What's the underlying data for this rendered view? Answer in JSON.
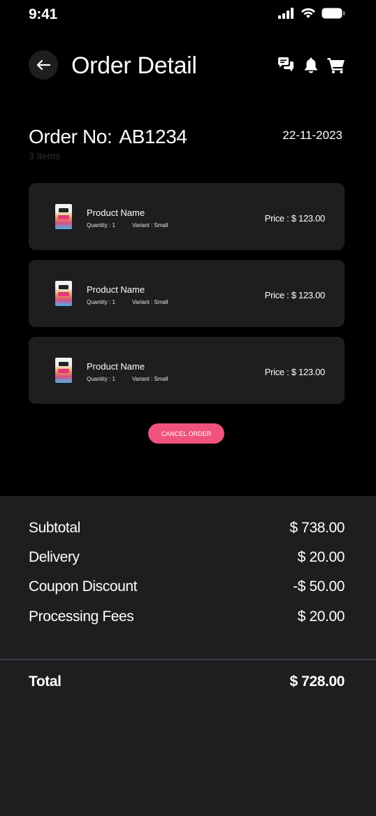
{
  "status_bar": {
    "time": "9:41"
  },
  "header": {
    "title": "Order Detail"
  },
  "order": {
    "number_label": "Order No:",
    "number": "AB1234",
    "date": "22-11-2023",
    "item_count": "3 items"
  },
  "items": [
    {
      "name": "Product Name",
      "quantity": "Quantity : 1",
      "variant": "Variant : Small",
      "price": "Price : $ 123.00"
    },
    {
      "name": "Product Name",
      "quantity": "Quantity : 1",
      "variant": "Variant : Small",
      "price": "Price : $ 123.00"
    },
    {
      "name": "Product Name",
      "quantity": "Quantity : 1",
      "variant": "Variant : Small",
      "price": "Price : $ 123.00"
    }
  ],
  "actions": {
    "cancel_label": "CANCEL ORDER"
  },
  "summary": {
    "rows": [
      {
        "label": "Subtotal",
        "value": "$ 738.00"
      },
      {
        "label": "Delivery",
        "value": "$ 20.00"
      },
      {
        "label": "Coupon Discount",
        "value": "-$ 50.00"
      },
      {
        "label": "Processing Fees",
        "value": "$ 20.00"
      }
    ],
    "total_label": "Total",
    "total_value": "$ 728.00"
  },
  "icons": {
    "back": "arrow-left-icon",
    "chat": "chat-icon",
    "notifications": "bell-icon",
    "cart": "cart-icon"
  },
  "colors": {
    "background": "#000000",
    "card": "#1e1d20",
    "accent": "#f0527e"
  }
}
